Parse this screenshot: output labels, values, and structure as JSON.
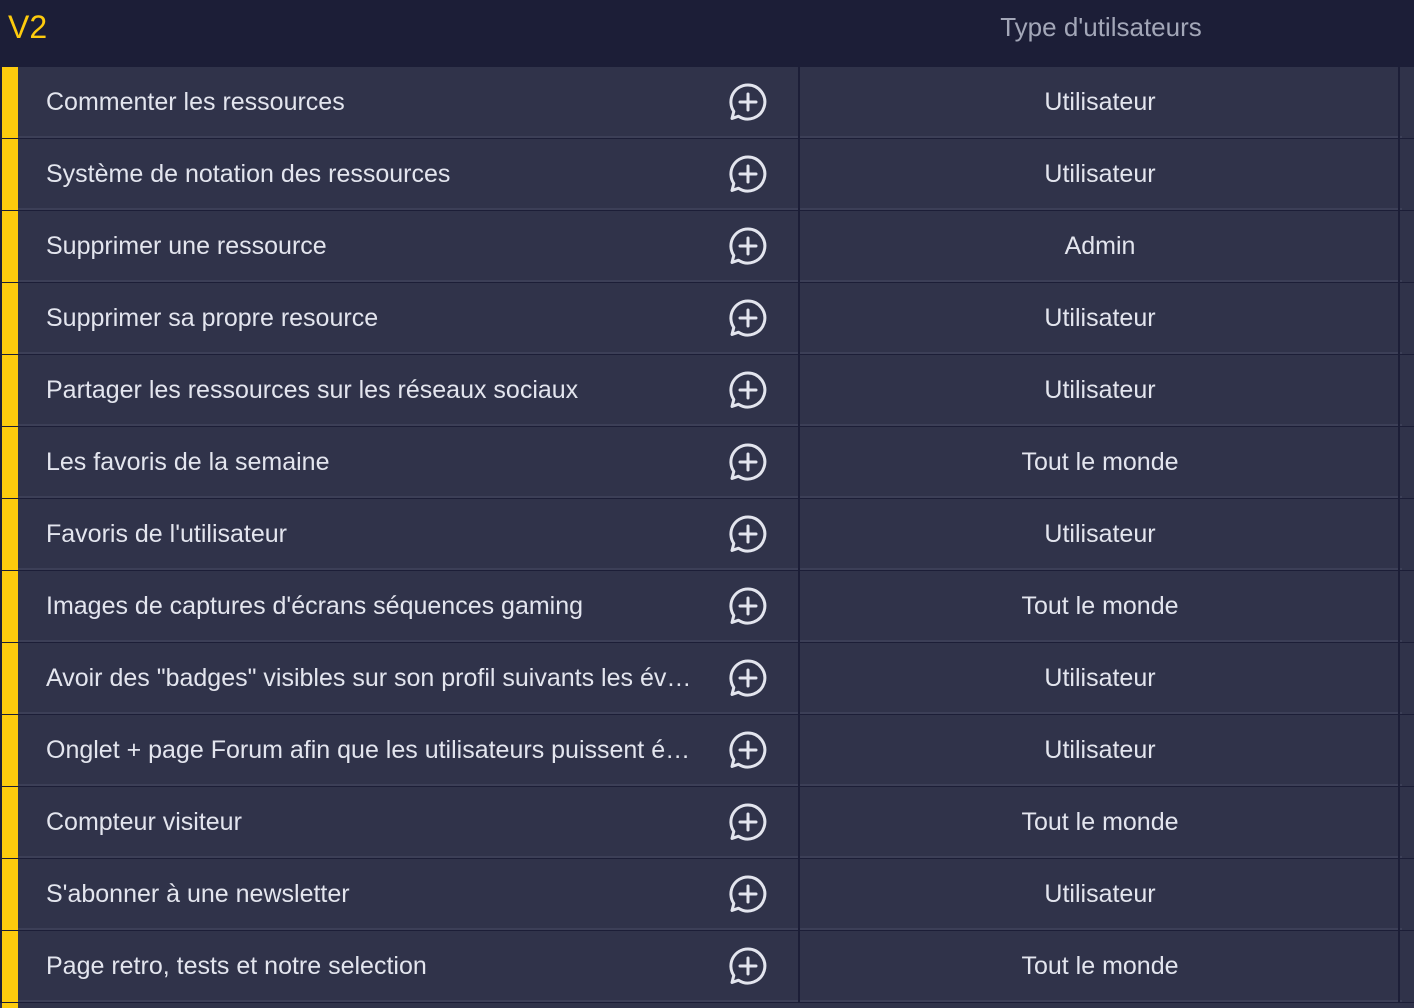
{
  "group": {
    "title": "V2",
    "accent_color": "#fdcb0d"
  },
  "columns": {
    "type_header": "Type d'utilsateurs"
  },
  "rows": [
    {
      "name": "Commenter les ressources",
      "type": "Utilisateur"
    },
    {
      "name": "Système de notation des ressources",
      "type": "Utilisateur"
    },
    {
      "name": "Supprimer une ressource",
      "type": "Admin"
    },
    {
      "name": "Supprimer sa propre resource",
      "type": "Utilisateur"
    },
    {
      "name": "Partager les ressources sur les réseaux sociaux",
      "type": "Utilisateur"
    },
    {
      "name": "Les favoris de la semaine",
      "type": "Tout le monde"
    },
    {
      "name": "Favoris de l'utilisateur",
      "type": "Utilisateur"
    },
    {
      "name": "Images de captures d'écrans séquences gaming",
      "type": "Tout le monde"
    },
    {
      "name": "Avoir des \"badges\" visibles sur son profil suivants les év…",
      "type": "Utilisateur"
    },
    {
      "name": "Onglet + page Forum afin que les utilisateurs puissent é…",
      "type": "Utilisateur"
    },
    {
      "name": "Compteur visiteur",
      "type": "Tout le monde"
    },
    {
      "name": "S'abonner à une newsletter",
      "type": "Utilisateur"
    },
    {
      "name": "Page retro, tests et notre selection",
      "type": "Tout le monde"
    }
  ],
  "icons": {
    "add_update": "add-update-bubble-icon"
  }
}
